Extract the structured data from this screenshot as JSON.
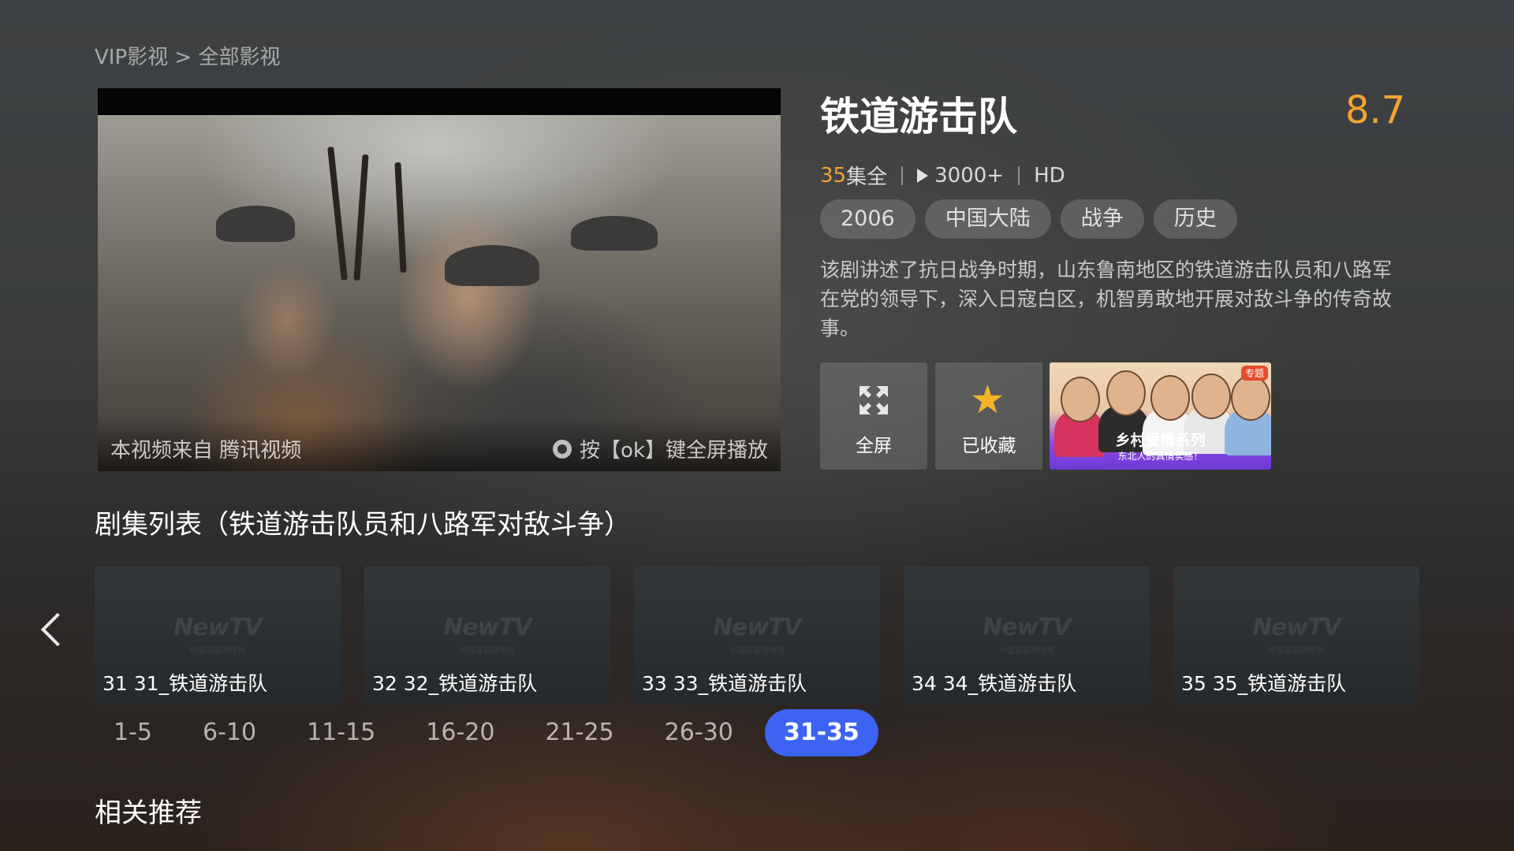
{
  "breadcrumb": "VIP影视 > 全部影视",
  "player": {
    "source_text": "本视频来自 腾讯视频",
    "hint_text": "按【ok】键全屏播放"
  },
  "show": {
    "title": "铁道游击队",
    "score": "8.7",
    "episode_count": "35",
    "episode_suffix": "集全",
    "plays": "3000+",
    "quality": "HD",
    "tags": [
      "2006",
      "中国大陆",
      "战争",
      "历史"
    ],
    "description": "该剧讲述了抗日战争时期，山东鲁南地区的铁道游击队员和八路军在党的领导下，深入日寇白区，机智勇敢地开展对敌斗争的传奇故事。"
  },
  "actions": {
    "fullscreen_label": "全屏",
    "favorite_label": "已收藏"
  },
  "promo": {
    "badge": "专题",
    "title": "乡村爱情系列",
    "subtitle": "东北人的真情实感！"
  },
  "episode_section_title": "剧集列表（铁道游击队员和八路军对敌斗争）",
  "episodes": [
    {
      "label": "31 31_铁道游击队",
      "logo": "NewTV",
      "logo_sub": "中国互联网电视"
    },
    {
      "label": "32 32_铁道游击队",
      "logo": "NewTV",
      "logo_sub": "中国互联网电视"
    },
    {
      "label": "33 33_铁道游击队",
      "logo": "NewTV",
      "logo_sub": "中国互联网电视"
    },
    {
      "label": "34 34_铁道游击队",
      "logo": "NewTV",
      "logo_sub": "中国互联网电视"
    },
    {
      "label": "35 35_铁道游击队",
      "logo": "NewTV",
      "logo_sub": "中国互联网电视"
    }
  ],
  "ranges": [
    "1-5",
    "6-10",
    "11-15",
    "16-20",
    "21-25",
    "26-30",
    "31-35"
  ],
  "active_range": "31-35",
  "related_section_title": "相关推荐",
  "colors": {
    "accent_blue": "#3d63f2",
    "score_orange": "#f4a431",
    "star_gold": "#f4b429"
  }
}
